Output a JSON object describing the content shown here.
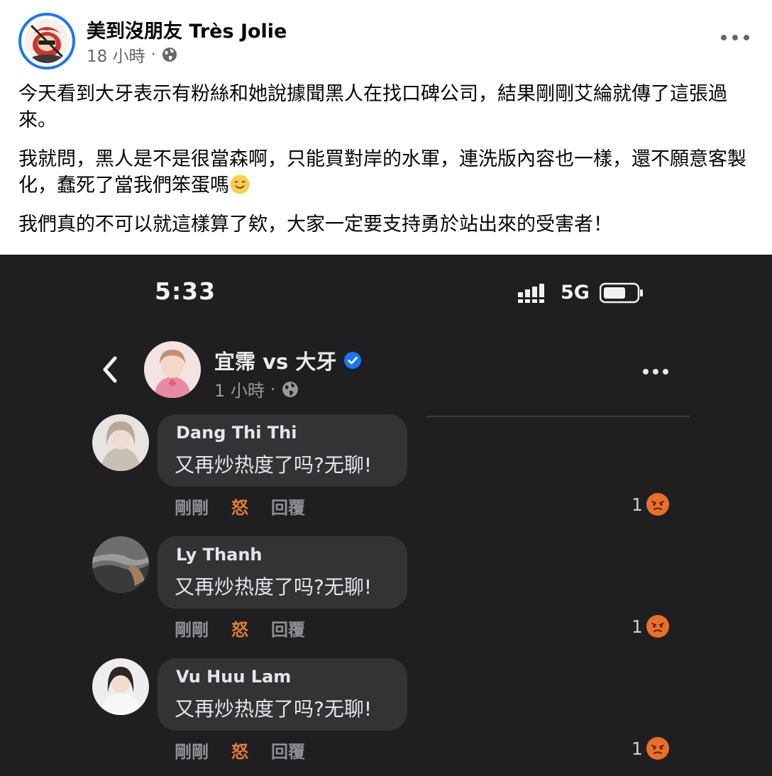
{
  "post": {
    "author": "美到沒朋友 Très Jolie",
    "time": "18 小時",
    "separator": "·",
    "paragraphs": [
      "今天看到大牙表示有粉絲和她說據聞黑人在找口碑公司，結果剛剛艾綸就傳了這張過來。",
      "我就問，黑人是不是很當森啊，只能買對岸的水軍，連洗版內容也一樣，還不願意客製化，蠢死了當我們笨蛋嗎",
      "我們真的不可以就這樣算了欸，大家一定要支持勇於站出來的受害者！"
    ],
    "emoji": "smiling-face-icon"
  },
  "screenshot": {
    "status": {
      "clock": "5:33",
      "network": "5G"
    },
    "page": {
      "name": "宜霈 vs 大牙",
      "time": "1 小時",
      "separator": "·"
    },
    "comments": [
      {
        "name": "Dang Thi Thi",
        "text": "又再炒热度了吗?无聊!",
        "time": "剛剛",
        "reaction_label": "怒",
        "reply": "回覆",
        "reaction_count": "1"
      },
      {
        "name": "Ly Thanh",
        "text": "又再炒热度了吗?无聊!",
        "time": "剛剛",
        "reaction_label": "怒",
        "reply": "回覆",
        "reaction_count": "1"
      },
      {
        "name": "Vu Huu Lam",
        "text": "又再炒热度了吗?无聊!",
        "time": "剛剛",
        "reaction_label": "怒",
        "reply": "回覆",
        "reaction_count": "1"
      }
    ]
  },
  "colors": {
    "accent": "#1877f2",
    "angry": "#e07a3b",
    "dark_bg": "#1f1f21",
    "bubble": "#333335"
  }
}
